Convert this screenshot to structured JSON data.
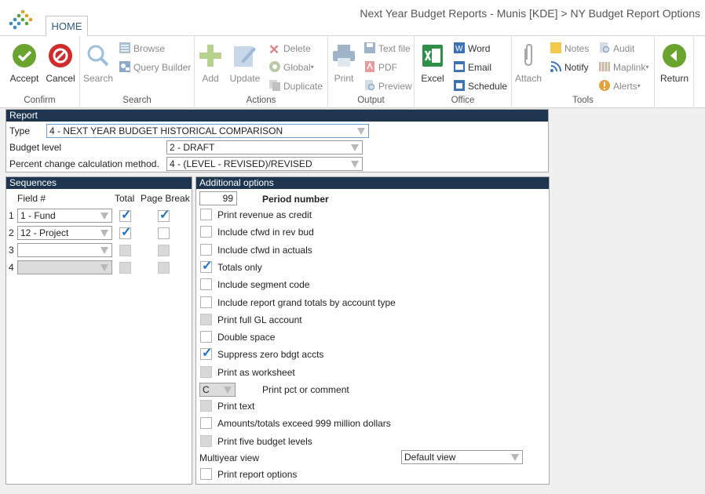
{
  "window": {
    "title": "Next Year Budget Reports - Munis [KDE] > NY Budget Report Options"
  },
  "tabs": {
    "home": "HOME"
  },
  "ribbon": {
    "confirm": {
      "label": "Confirm",
      "accept": "Accept",
      "cancel": "Cancel"
    },
    "search": {
      "label": "Search",
      "search": "Search",
      "browse": "Browse",
      "query_builder": "Query Builder"
    },
    "actions": {
      "label": "Actions",
      "add": "Add",
      "update": "Update",
      "delete": "Delete",
      "global": "Global",
      "duplicate": "Duplicate"
    },
    "output": {
      "label": "Output",
      "print": "Print",
      "text_file": "Text file",
      "pdf": "PDF",
      "preview": "Preview"
    },
    "office": {
      "label": "Office",
      "excel": "Excel",
      "word": "Word",
      "email": "Email",
      "schedule": "Schedule"
    },
    "tools": {
      "label": "Tools",
      "attach": "Attach",
      "notes": "Notes",
      "notify": "Notify",
      "audit": "Audit",
      "maplink": "Maplink",
      "alerts": "Alerts"
    },
    "return": "Return"
  },
  "report": {
    "header": "Report",
    "type_label": "Type",
    "type_value": "4 - NEXT YEAR BUDGET HISTORICAL COMPARISON",
    "budget_level_label": "Budget level",
    "budget_level_value": "2 - DRAFT",
    "pct_method_label": "Percent change calculation method.",
    "pct_method_value": "4 - (LEVEL - REVISED)/REVISED"
  },
  "sequences": {
    "header": "Sequences",
    "col_field": "Field #",
    "col_total": "Total",
    "col_page_break": "Page Break",
    "rows": [
      {
        "num": "1",
        "field": "1 - Fund",
        "total": true,
        "page_break": true,
        "enabled": true
      },
      {
        "num": "2",
        "field": "12 - Project",
        "total": true,
        "page_break": false,
        "enabled": true
      },
      {
        "num": "3",
        "field": "",
        "total": false,
        "page_break": false,
        "enabled": false
      },
      {
        "num": "4",
        "field": "",
        "total": false,
        "page_break": false,
        "enabled": false
      }
    ]
  },
  "additional": {
    "header": "Additional options",
    "period_number_value": "99",
    "period_number_label": "Period number",
    "options": [
      {
        "label": "Print revenue as credit",
        "checked": false,
        "enabled": true
      },
      {
        "label": "Include cfwd in rev bud",
        "checked": false,
        "enabled": true
      },
      {
        "label": "Include cfwd in actuals",
        "checked": false,
        "enabled": true
      },
      {
        "label": "Totals only",
        "checked": true,
        "enabled": true
      },
      {
        "label": "Include segment code",
        "checked": false,
        "enabled": true
      },
      {
        "label": "Include report grand totals by account type",
        "checked": false,
        "enabled": true
      },
      {
        "label": "Print full GL account",
        "checked": false,
        "enabled": false
      },
      {
        "label": "Double space",
        "checked": false,
        "enabled": true
      },
      {
        "label": "Suppress zero bdgt accts",
        "checked": true,
        "enabled": true
      },
      {
        "label": "Print as worksheet",
        "checked": false,
        "enabled": false
      }
    ],
    "pct_comment_value": "C",
    "pct_comment_label": "Print pct or comment",
    "options2": [
      {
        "label": "Print text",
        "checked": false,
        "enabled": false
      },
      {
        "label": "Amounts/totals exceed 999 million dollars",
        "checked": false,
        "enabled": true
      },
      {
        "label": "Print five budget levels",
        "checked": false,
        "enabled": false
      }
    ],
    "multiyear_label": "Multiyear view",
    "multiyear_value": "Default view",
    "print_options_label": "Print report options"
  },
  "colors": {
    "panel_header": "#1e3550",
    "check": "#1e6fc7",
    "accept": "#6aa32e",
    "cancel": "#d22a2a",
    "return": "#6aa32e"
  }
}
